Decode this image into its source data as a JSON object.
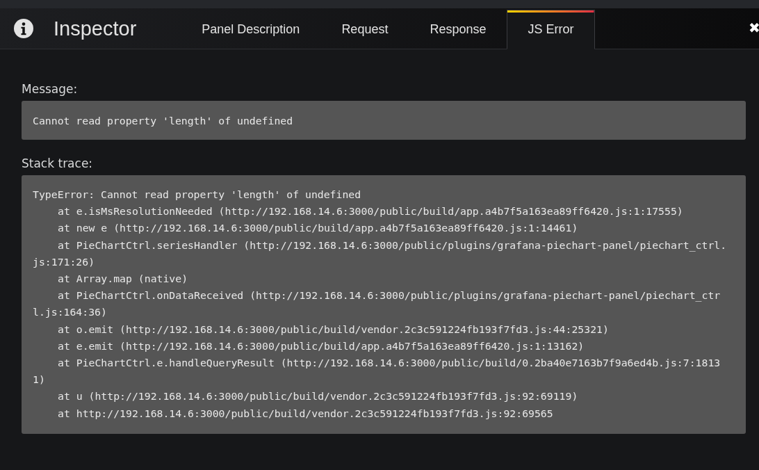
{
  "header": {
    "title": "Inspector",
    "close": "✖"
  },
  "tabs": [
    {
      "label": "Panel Description",
      "selected": false
    },
    {
      "label": "Request",
      "selected": false
    },
    {
      "label": "Response",
      "selected": false
    },
    {
      "label": "JS Error",
      "selected": true
    }
  ],
  "message": {
    "label": "Message:",
    "text": "Cannot read property 'length' of undefined"
  },
  "stack_trace": {
    "label": "Stack trace:",
    "lines": [
      {
        "kind": "header",
        "text": "TypeError: Cannot read property 'length' of undefined"
      },
      {
        "kind": "frame",
        "text": "at e.isMsResolutionNeeded (http://192.168.14.6:3000/public/build/app.a4b7f5a163ea89ff6420.js:1:17555)"
      },
      {
        "kind": "frame",
        "text": "at new e (http://192.168.14.6:3000/public/build/app.a4b7f5a163ea89ff6420.js:1:14461)"
      },
      {
        "kind": "frame",
        "text": "at PieChartCtrl.seriesHandler (http://192.168.14.6:3000/public/plugins/grafana-piechart-panel/piechart_ctrl."
      },
      {
        "kind": "continuation",
        "text": "js:171:26)"
      },
      {
        "kind": "frame",
        "text": "at Array.map (native)"
      },
      {
        "kind": "frame",
        "text": "at PieChartCtrl.onDataReceived (http://192.168.14.6:3000/public/plugins/grafana-piechart-panel/piechart_ctr"
      },
      {
        "kind": "continuation",
        "text": "l.js:164:36)"
      },
      {
        "kind": "frame",
        "text": "at o.emit (http://192.168.14.6:3000/public/build/vendor.2c3c591224fb193f7fd3.js:44:25321)"
      },
      {
        "kind": "frame",
        "text": "at e.emit (http://192.168.14.6:3000/public/build/app.a4b7f5a163ea89ff6420.js:1:13162)"
      },
      {
        "kind": "frame",
        "text": "at PieChartCtrl.e.handleQueryResult (http://192.168.14.6:3000/public/build/0.2ba40e7163b7f9a6ed4b.js:7:1813"
      },
      {
        "kind": "continuation",
        "text": "1)"
      },
      {
        "kind": "frame",
        "text": "at u (http://192.168.14.6:3000/public/build/vendor.2c3c591224fb193f7fd3.js:92:69119)"
      },
      {
        "kind": "frame",
        "text": "at http://192.168.14.6:3000/public/build/vendor.2c3c591224fb193f7fd3.js:92:69565"
      }
    ]
  }
}
